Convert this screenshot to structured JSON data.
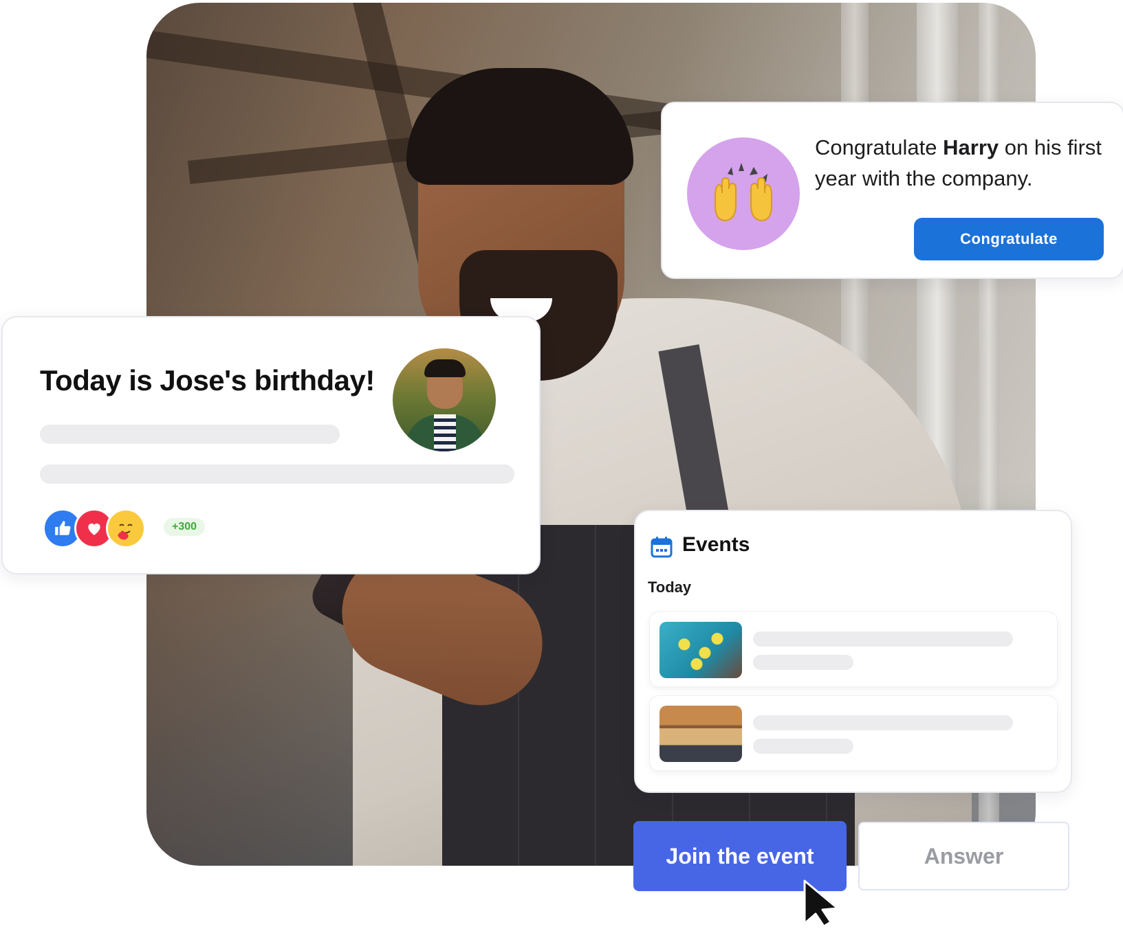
{
  "congrats_card": {
    "text_prefix": "Congratulate ",
    "name": "Harry",
    "text_suffix": " on his first year with the company.",
    "emoji": "🙌",
    "button_label": "Congratulate"
  },
  "birthday_card": {
    "title": "Today is Jose's birthday!",
    "reaction_count": "+300",
    "reactions": [
      "like-icon",
      "heart-icon",
      "care-icon"
    ]
  },
  "events_card": {
    "title": "Events",
    "section_label": "Today",
    "icon": "calendar-icon"
  },
  "actions": {
    "join_label": "Join the event",
    "answer_label": "Answer"
  },
  "colors": {
    "primary_blue": "#1b72d9",
    "join_blue": "#4766e6",
    "emoji_bg": "#d5a2ec",
    "count_green": "#3fa83a"
  }
}
